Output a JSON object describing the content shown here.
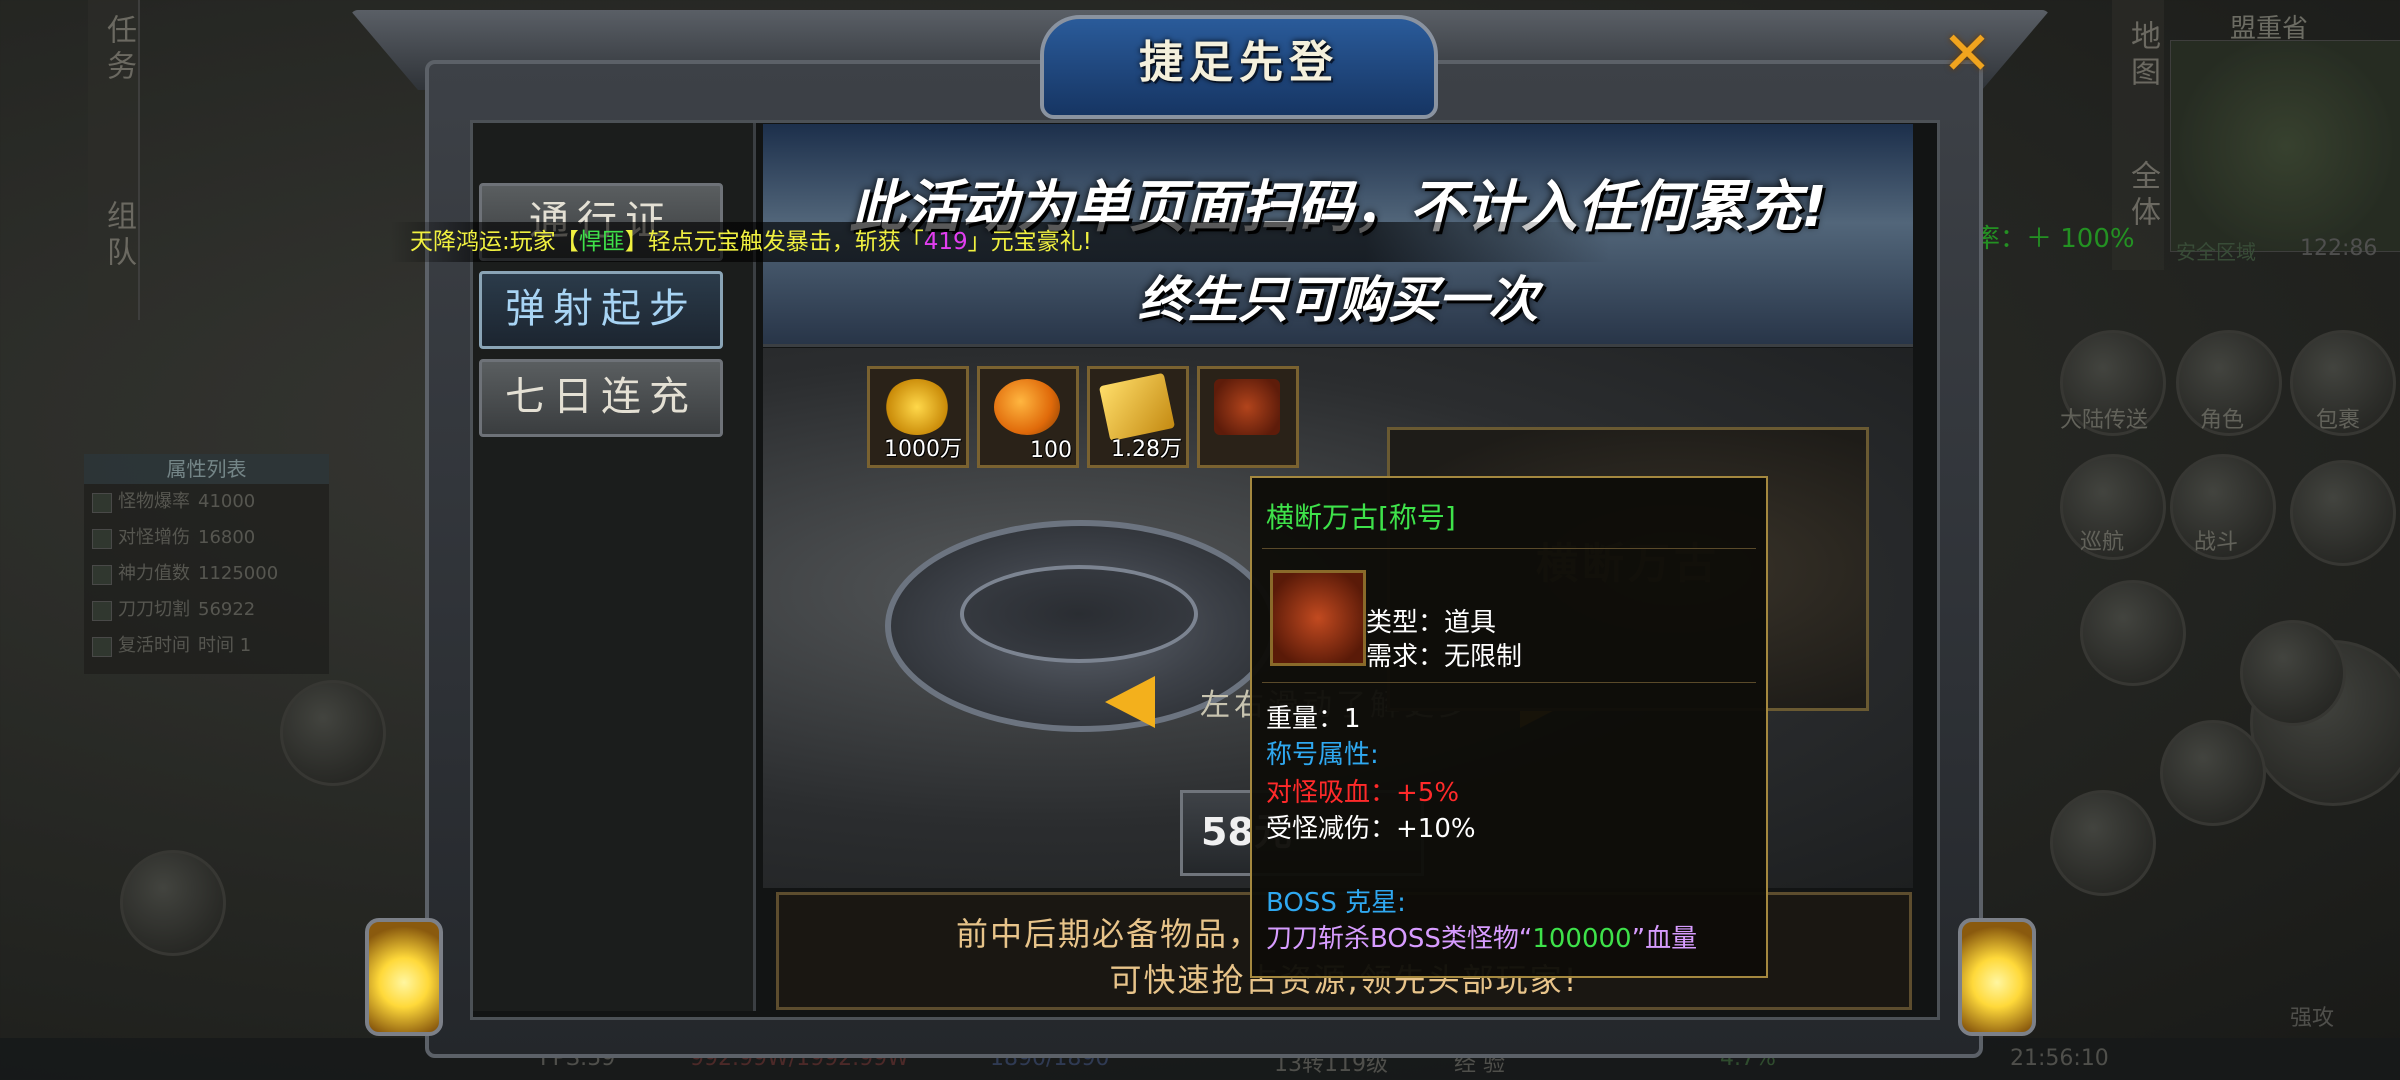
{
  "hud": {
    "left_rail": [
      "任务",
      "组队"
    ],
    "attr_panel": {
      "title": "属性列表",
      "rows": [
        {
          "label": "怪物爆率",
          "value": "41000"
        },
        {
          "label": "对怪增伤",
          "value": "16800"
        },
        {
          "label": "神力值数",
          "value": "1125000"
        },
        {
          "label": "刀刀切割",
          "value": "56922"
        },
        {
          "label": "复活时间",
          "value": "时间 1"
        }
      ]
    },
    "right_rail": [
      "地图",
      "全体"
    ],
    "map_name": "盟重省",
    "safe_zone": "安全区域",
    "coords": "122:86",
    "crit_rate": "暴击几率：＋ 100%",
    "skills": [
      "大陆传送",
      "角色",
      "包裹",
      "巡航",
      "战斗"
    ],
    "bottom": {
      "fps": "FPS:59",
      "hp": "992.99W/1992.99W",
      "mp": "1890/1890",
      "level": "13转119级",
      "exp_label": "经 验",
      "exp_pct": "4.7%",
      "clock": "21:56:10",
      "strong_attack": "强攻"
    }
  },
  "modal": {
    "title": "捷足先登",
    "close_icon": "close-x-icon",
    "tabs": [
      "通行证",
      "弹射起步",
      "七日连充"
    ],
    "active_tab": 1,
    "banner": {
      "line1": "此活动为单页面扫码，不计入任何累充!",
      "line2": "终生只可购买一次"
    },
    "marquee": {
      "prefix": "天降鸿运:玩家【",
      "player": "悍匪",
      "middle": "】轻点元宝触发暴击，斩获「",
      "amount": "419",
      "suffix": "」元宝豪礼!"
    },
    "rewards": [
      {
        "icon": "gold-ingots-icon",
        "qty": "1000万"
      },
      {
        "icon": "orange-coin-icon",
        "qty": "100"
      },
      {
        "icon": "gold-ticket-icon",
        "qty": "1.28万"
      },
      {
        "icon": "dragon-title-icon",
        "qty": ""
      }
    ],
    "preview_title": "横断万古",
    "hint": "左右滑动了解更多",
    "price": "58元",
    "footer": {
      "line1": "前中后期必备物品，",
      "line2": "可快速抢占资源,领先头部玩家!"
    }
  },
  "tooltip": {
    "name": "横断万古[称号]",
    "type": "类型：道具",
    "requirement": "需求：无限制",
    "weight": "重量：1",
    "attr_header": "称号属性:",
    "lifesteal": "对怪吸血：+5%",
    "damage_reduction": "受怪减伤：+10%",
    "boss_header": "BOSS 克星:",
    "boss_prefix": "刀刀斩杀BOSS类怪物“",
    "boss_value": "100000",
    "boss_suffix": "”血量"
  },
  "colors": {
    "accent_green": "#3ee24a",
    "accent_blue": "#2fa8f0",
    "accent_red": "#ff2a2a",
    "gold_border": "#a4883f",
    "close_orange": "#f1a41e"
  }
}
